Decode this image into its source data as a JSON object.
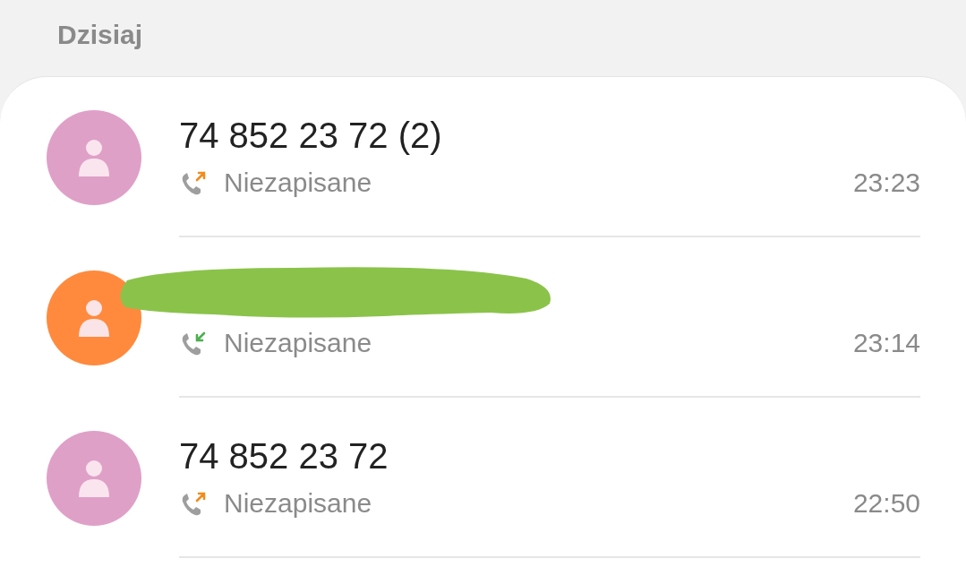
{
  "section_header": "Dzisiaj",
  "calls": [
    {
      "number": "74 852 23 72 (2)",
      "redacted": false,
      "color": "#dfa0c8",
      "kind": "outgoing",
      "label": "Niezapisane",
      "time": "23:23"
    },
    {
      "redacted": true,
      "color": "#ff8a3d",
      "kind": "incoming",
      "label": "Niezapisane",
      "time": "23:14"
    },
    {
      "number": "74 852 23 72",
      "redacted": false,
      "color": "#dfa0c8",
      "kind": "outgoing",
      "label": "Niezapisane",
      "time": "22:50"
    }
  ]
}
